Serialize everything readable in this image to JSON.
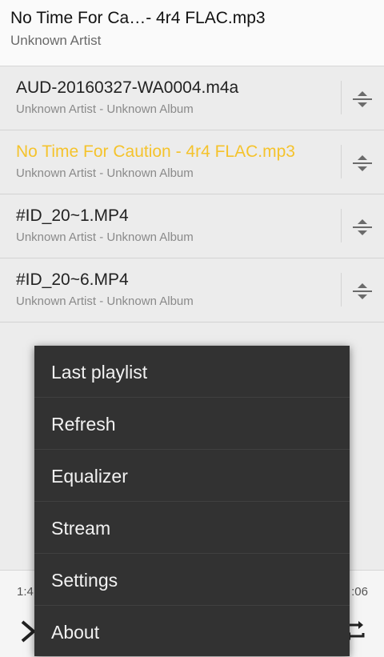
{
  "header": {
    "title": "No Time For Ca…- 4r4 FLAC.mp3",
    "subtitle": "Unknown Artist"
  },
  "playlist": [
    {
      "title": "AUD-20160327-WA0004.m4a",
      "subtitle": "Unknown Artist - Unknown Album",
      "active": false
    },
    {
      "title": "No Time For Caution - 4r4 FLAC.mp3",
      "subtitle": "Unknown Artist - Unknown Album",
      "active": true
    },
    {
      "title": "#ID_20~1.MP4",
      "subtitle": "Unknown Artist - Unknown Album",
      "active": false
    },
    {
      "title": "#ID_20~6.MP4",
      "subtitle": "Unknown Artist - Unknown Album",
      "active": false
    }
  ],
  "player": {
    "elapsed": "1:4",
    "duration": ":06"
  },
  "menu": {
    "items": [
      "Last playlist",
      "Refresh",
      "Equalizer",
      "Stream",
      "Settings",
      "About"
    ]
  },
  "colors": {
    "accent": "#f5c32c",
    "menu_bg": "#323232"
  }
}
